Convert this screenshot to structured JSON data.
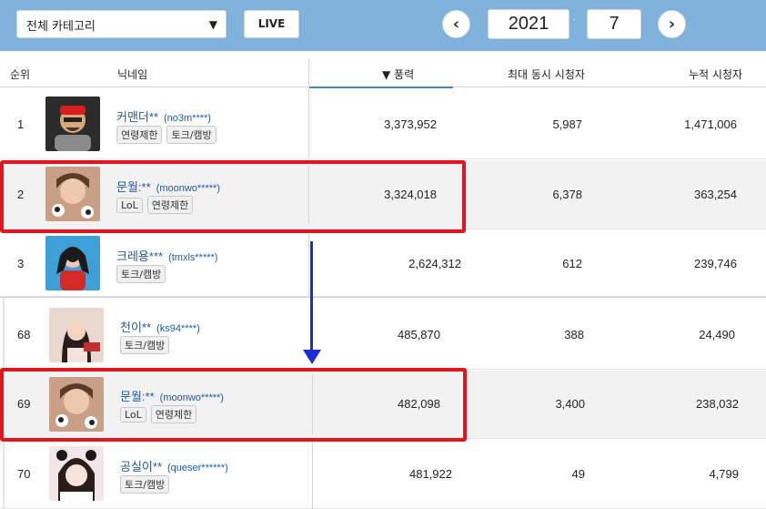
{
  "toolbar": {
    "category": "전체 카테고리",
    "live_label": "LIVE",
    "year": "2021",
    "month": "7",
    "prev_icon": "chevron-left-icon",
    "next_icon": "chevron-right-icon"
  },
  "header": {
    "rank": "순위",
    "nickname": "닉네임",
    "power": "▼ 풍력",
    "max_viewers": "최대 동시 시청자",
    "total_viewers": "누적 시청자"
  },
  "rows": [
    {
      "rank": "1",
      "nick": "커맨더**",
      "uid": "(no3m****)",
      "tags": [
        "연령제한",
        "토크/캠방"
      ],
      "power": "3,373,952",
      "max": "5,987",
      "total": "1,471,006"
    },
    {
      "rank": "2",
      "nick": "문월:**",
      "uid": "(moonwo*****)",
      "tags": [
        "LoL",
        "연령제한"
      ],
      "power": "3,324,018",
      "max": "6,378",
      "total": "363,254"
    },
    {
      "rank": "3",
      "nick": "크레용***",
      "uid": "(tmxls*****)",
      "tags": [
        "토크/캠방"
      ],
      "power": "2,624,312",
      "max": "612",
      "total": "239,746"
    },
    {
      "rank": "68",
      "nick": "천이**",
      "uid": "(ks94****)",
      "tags": [
        "토크/캠방"
      ],
      "power": "485,870",
      "max": "388",
      "total": "24,490"
    },
    {
      "rank": "69",
      "nick": "문월:**",
      "uid": "(moonwo*****)",
      "tags": [
        "LoL",
        "연령제한"
      ],
      "power": "482,098",
      "max": "3,400",
      "total": "238,032"
    },
    {
      "rank": "70",
      "nick": "공실이**",
      "uid": "(queser******)",
      "tags": [
        "토크/캠방"
      ],
      "power": "481,922",
      "max": "49",
      "total": "4,799"
    }
  ],
  "colors": {
    "toolbar_bg": "#7fb3dc",
    "highlight": "#e0161c",
    "arrow": "#1d2dd6",
    "nick": "#1e5aa0"
  }
}
